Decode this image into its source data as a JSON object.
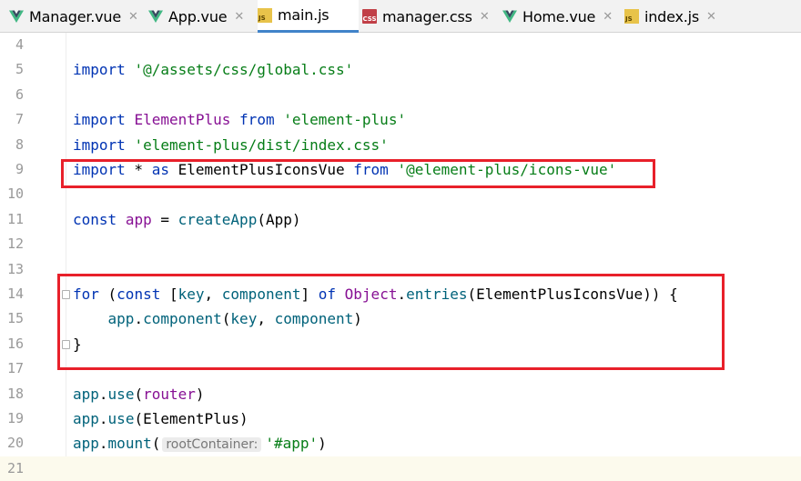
{
  "tabs": [
    {
      "label": "Manager.vue",
      "icon": "vue-icon",
      "active": false
    },
    {
      "label": "App.vue",
      "icon": "vue-icon",
      "active": false
    },
    {
      "label": "main.js",
      "icon": "js-file-icon",
      "active": true
    },
    {
      "label": "manager.css",
      "icon": "css-file-icon",
      "active": false
    },
    {
      "label": "Home.vue",
      "icon": "vue-icon",
      "active": false
    },
    {
      "label": "index.js",
      "icon": "js-file-icon",
      "active": false
    }
  ],
  "tab_close_glyph": "✕",
  "js_icon_text": "JS",
  "css_icon_text": "CSS",
  "colors": {
    "vue_green": "#41b883",
    "vue_dark": "#35495e",
    "highlight_box": "#e8202a",
    "keyword": "#0033b3",
    "string": "#067d17",
    "function": "#00627a",
    "identifier": "#871094"
  },
  "lines": [
    {
      "n": "4",
      "tokens": []
    },
    {
      "n": "5",
      "tokens": [
        {
          "t": "k",
          "v": "import"
        },
        {
          "t": "p",
          "v": " "
        },
        {
          "t": "s",
          "v": "'@/assets/css/global.css'"
        }
      ]
    },
    {
      "n": "6",
      "tokens": []
    },
    {
      "n": "7",
      "tokens": [
        {
          "t": "k",
          "v": "import"
        },
        {
          "t": "p",
          "v": " "
        },
        {
          "t": "v",
          "v": "ElementPlus"
        },
        {
          "t": "p",
          "v": " "
        },
        {
          "t": "k",
          "v": "from"
        },
        {
          "t": "p",
          "v": " "
        },
        {
          "t": "s",
          "v": "'element-plus'"
        }
      ]
    },
    {
      "n": "8",
      "tokens": [
        {
          "t": "k",
          "v": "import"
        },
        {
          "t": "p",
          "v": " "
        },
        {
          "t": "s",
          "v": "'element-plus/dist/index.css'"
        }
      ]
    },
    {
      "n": "9",
      "tokens": [
        {
          "t": "k",
          "v": "import"
        },
        {
          "t": "p",
          "v": " * "
        },
        {
          "t": "k",
          "v": "as"
        },
        {
          "t": "p",
          "v": " ElementPlusIconsVue "
        },
        {
          "t": "k",
          "v": "from"
        },
        {
          "t": "p",
          "v": " "
        },
        {
          "t": "s",
          "v": "'@element-plus/icons-vue'"
        }
      ]
    },
    {
      "n": "10",
      "tokens": []
    },
    {
      "n": "11",
      "tokens": [
        {
          "t": "k",
          "v": "const"
        },
        {
          "t": "p",
          "v": " "
        },
        {
          "t": "v",
          "v": "app"
        },
        {
          "t": "p",
          "v": " = "
        },
        {
          "t": "f",
          "v": "createApp"
        },
        {
          "t": "p",
          "v": "(App)"
        }
      ]
    },
    {
      "n": "12",
      "tokens": []
    },
    {
      "n": "13",
      "tokens": []
    },
    {
      "n": "14",
      "tokens": [
        {
          "t": "k",
          "v": "for"
        },
        {
          "t": "p",
          "v": " ("
        },
        {
          "t": "k",
          "v": "const"
        },
        {
          "t": "p",
          "v": " ["
        },
        {
          "t": "f",
          "v": "key"
        },
        {
          "t": "p",
          "v": ", "
        },
        {
          "t": "f",
          "v": "component"
        },
        {
          "t": "p",
          "v": "] "
        },
        {
          "t": "k",
          "v": "of"
        },
        {
          "t": "p",
          "v": " "
        },
        {
          "t": "v",
          "v": "Object"
        },
        {
          "t": "p",
          "v": "."
        },
        {
          "t": "f",
          "v": "entries"
        },
        {
          "t": "p",
          "v": "(ElementPlusIconsVue)) {"
        }
      ]
    },
    {
      "n": "15",
      "tokens": [
        {
          "t": "p",
          "v": "    "
        },
        {
          "t": "f",
          "v": "app"
        },
        {
          "t": "p",
          "v": "."
        },
        {
          "t": "f",
          "v": "component"
        },
        {
          "t": "p",
          "v": "("
        },
        {
          "t": "f",
          "v": "key"
        },
        {
          "t": "p",
          "v": ", "
        },
        {
          "t": "f",
          "v": "component"
        },
        {
          "t": "p",
          "v": ")"
        }
      ]
    },
    {
      "n": "16",
      "tokens": [
        {
          "t": "p",
          "v": "}"
        }
      ]
    },
    {
      "n": "17",
      "tokens": []
    },
    {
      "n": "18",
      "tokens": [
        {
          "t": "f",
          "v": "app"
        },
        {
          "t": "p",
          "v": "."
        },
        {
          "t": "f",
          "v": "use"
        },
        {
          "t": "p",
          "v": "("
        },
        {
          "t": "v",
          "v": "router"
        },
        {
          "t": "p",
          "v": ")"
        }
      ]
    },
    {
      "n": "19",
      "tokens": [
        {
          "t": "f",
          "v": "app"
        },
        {
          "t": "p",
          "v": "."
        },
        {
          "t": "f",
          "v": "use"
        },
        {
          "t": "p",
          "v": "(ElementPlus)"
        }
      ]
    },
    {
      "n": "20",
      "tokens": [
        {
          "t": "f",
          "v": "app"
        },
        {
          "t": "p",
          "v": "."
        },
        {
          "t": "f",
          "v": "mount"
        },
        {
          "t": "p",
          "v": "("
        },
        {
          "t": "hint",
          "v": "rootContainer:"
        },
        {
          "t": "s",
          "v": "'#app'"
        },
        {
          "t": "p",
          "v": ")"
        }
      ]
    },
    {
      "n": "21",
      "tokens": [],
      "current": true
    }
  ]
}
